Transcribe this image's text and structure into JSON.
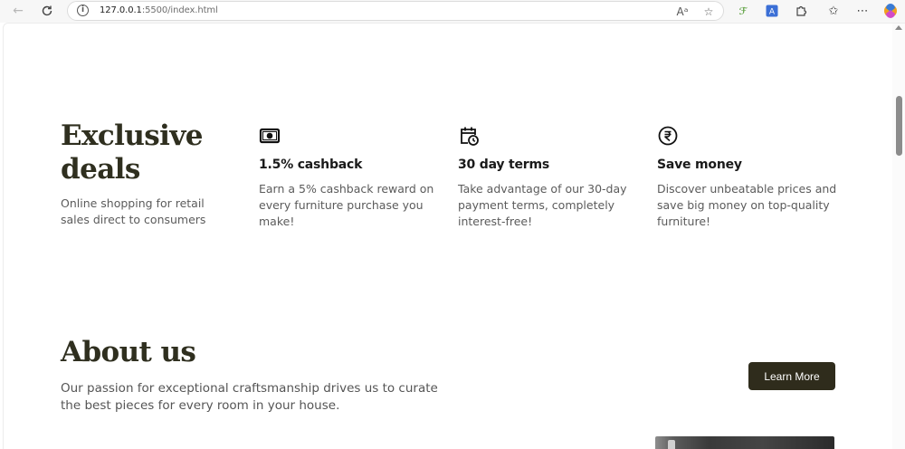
{
  "browser": {
    "url_host": "127.0.0.1",
    "url_path": ":5500/index.html",
    "icons": [
      "back-icon",
      "refresh-icon",
      "info-icon",
      "read-aloud-icon",
      "favorite-star-icon",
      "extension-icon",
      "translate-icon",
      "extensions-puzzle-icon",
      "favorites-icon",
      "more-icon",
      "copilot-icon"
    ]
  },
  "deals": {
    "title": "Exclusive deals",
    "subtitle": "Online shopping for retail sales direct to consumers"
  },
  "features": [
    {
      "icon": "cash-icon",
      "title": "1.5% cashback",
      "text": "Earn a 5% cashback reward on every furniture purchase you make!"
    },
    {
      "icon": "calendar-clock-icon",
      "title": "30 day terms",
      "text": "Take advantage of our 30-day payment terms, completely interest-free!"
    },
    {
      "icon": "rupee-icon",
      "title": "Save money",
      "text": "Discover unbeatable prices and save big money on top-quality furniture!"
    }
  ],
  "about": {
    "title": "About us",
    "text": "Our passion for exceptional craftsmanship drives us to curate the best pieces for every room in your house.",
    "button_label": "Learn More"
  },
  "colors": {
    "heading": "#2f2f1f",
    "button_bg": "#2f2c1c",
    "body_text": "#5b5b5b"
  }
}
